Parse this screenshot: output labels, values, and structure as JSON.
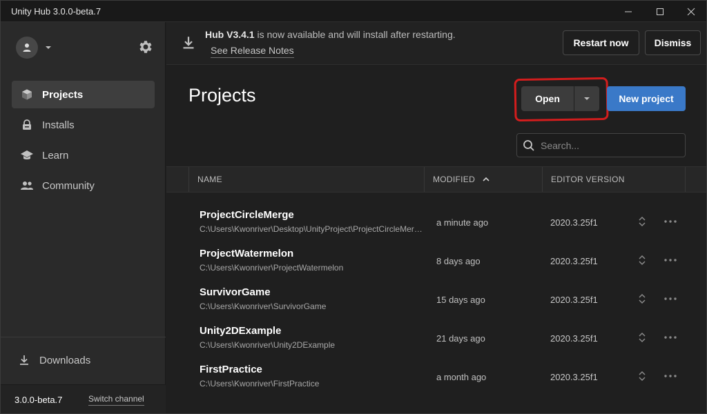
{
  "window": {
    "title": "Unity Hub 3.0.0-beta.7"
  },
  "sidebar": {
    "items": [
      {
        "label": "Projects",
        "icon": "cube-icon",
        "active": true
      },
      {
        "label": "Installs",
        "icon": "lock-icon",
        "active": false
      },
      {
        "label": "Learn",
        "icon": "graduation-cap-icon",
        "active": false
      },
      {
        "label": "Community",
        "icon": "people-icon",
        "active": false
      }
    ],
    "downloads_label": "Downloads",
    "version": "3.0.0-beta.7",
    "switch_channel_label": "Switch channel"
  },
  "banner": {
    "version_bold": "Hub V3.4.1",
    "message": " is now available and will install after restarting.",
    "release_notes_label": "See Release Notes",
    "restart_label": "Restart now",
    "dismiss_label": "Dismiss"
  },
  "main": {
    "title": "Projects",
    "open_label": "Open",
    "new_project_label": "New project",
    "search_placeholder": "Search...",
    "columns": {
      "name": "NAME",
      "modified": "MODIFIED",
      "editor_version": "EDITOR VERSION"
    },
    "projects": [
      {
        "name": "ProjectCircleMerge",
        "path": "C:\\Users\\Kwonriver\\Desktop\\UnityProject\\ProjectCircleMerge",
        "modified": "a minute ago",
        "version": "2020.3.25f1"
      },
      {
        "name": "ProjectWatermelon",
        "path": "C:\\Users\\Kwonriver\\ProjectWatermelon",
        "modified": "8 days ago",
        "version": "2020.3.25f1"
      },
      {
        "name": "SurvivorGame",
        "path": "C:\\Users\\Kwonriver\\SurvivorGame",
        "modified": "15 days ago",
        "version": "2020.3.25f1"
      },
      {
        "name": "Unity2DExample",
        "path": "C:\\Users\\Kwonriver\\Unity2DExample",
        "modified": "21 days ago",
        "version": "2020.3.25f1"
      },
      {
        "name": "FirstPractice",
        "path": "C:\\Users\\Kwonriver\\FirstPractice",
        "modified": "a month ago",
        "version": "2020.3.25f1"
      }
    ]
  },
  "colors": {
    "accent": "#3a79c8",
    "highlight": "#d31d1d",
    "sidebar_bg": "#2a2a2a",
    "main_bg": "#1f1f1f"
  }
}
